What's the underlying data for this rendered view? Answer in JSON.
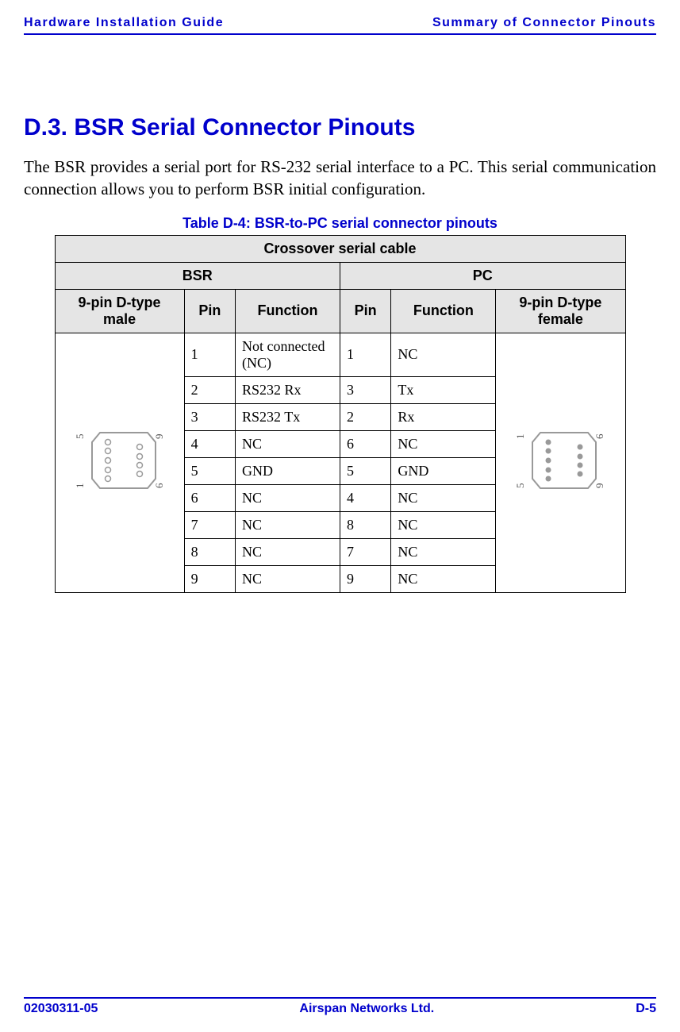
{
  "header": {
    "left": "Hardware Installation Guide",
    "right": "Summary of Connector Pinouts"
  },
  "section": {
    "heading": "D.3. BSR Serial Connector Pinouts",
    "body": "The BSR provides a serial port for RS-232 serial interface to a PC. This serial communication connection allows you to perform BSR initial configuration."
  },
  "table": {
    "caption": "Table D-4:  BSR-to-PC serial connector pinouts",
    "top_header": "Crossover serial cable",
    "sub_header_left": "BSR",
    "sub_header_right": "PC",
    "col_headers": {
      "conn_left": "9-pin D-type male",
      "pin_left": "Pin",
      "func_left": "Function",
      "pin_right": "Pin",
      "func_right": "Function",
      "conn_right": "9-pin D-type female"
    },
    "rows": [
      {
        "pin_l": "1",
        "func_l": "Not connected (NC)",
        "pin_r": "1",
        "func_r": "NC"
      },
      {
        "pin_l": "2",
        "func_l": "RS232 Rx",
        "pin_r": "3",
        "func_r": "Tx"
      },
      {
        "pin_l": "3",
        "func_l": "RS232 Tx",
        "pin_r": "2",
        "func_r": "Rx"
      },
      {
        "pin_l": "4",
        "func_l": "NC",
        "pin_r": "6",
        "func_r": "NC"
      },
      {
        "pin_l": "5",
        "func_l": "GND",
        "pin_r": "5",
        "func_r": "GND"
      },
      {
        "pin_l": "6",
        "func_l": "NC",
        "pin_r": "4",
        "func_r": "NC"
      },
      {
        "pin_l": "7",
        "func_l": "NC",
        "pin_r": "8",
        "func_r": "NC"
      },
      {
        "pin_l": "8",
        "func_l": "NC",
        "pin_r": "7",
        "func_r": "NC"
      },
      {
        "pin_l": "9",
        "func_l": "NC",
        "pin_r": "9",
        "func_r": "NC"
      }
    ],
    "male_labels": {
      "top_left": "5",
      "top_right": "9",
      "bot_left": "1",
      "bot_right": "6"
    },
    "female_labels": {
      "top_left": "1",
      "top_right": "6",
      "bot_left": "5",
      "bot_right": "9"
    }
  },
  "footer": {
    "left": "02030311-05",
    "center": "Airspan Networks Ltd.",
    "right": "D-5"
  }
}
